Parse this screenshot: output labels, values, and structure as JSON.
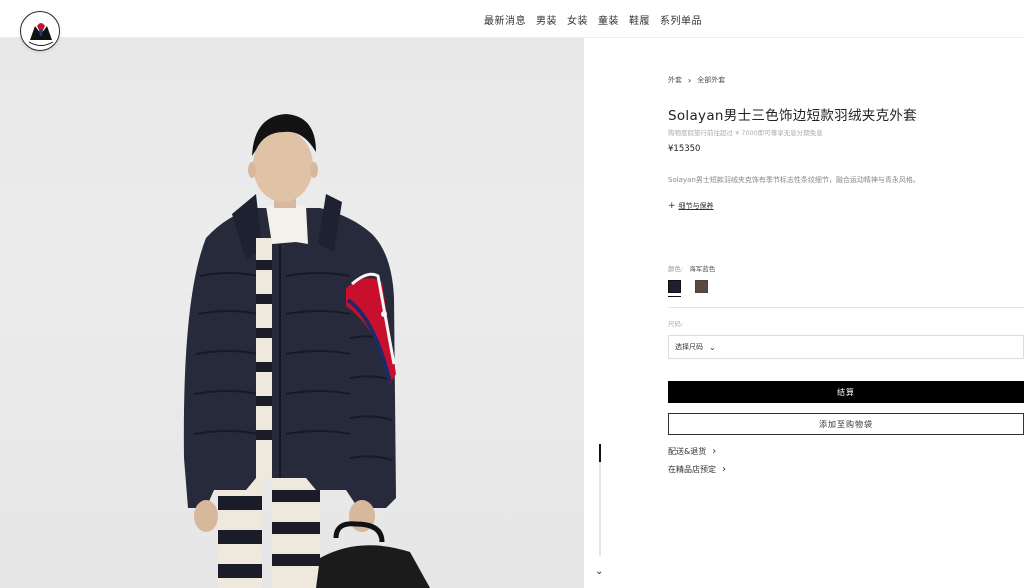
{
  "header": {
    "logo_text": "MONCLER",
    "nav": [
      "最新消息",
      "男装",
      "女装",
      "童装",
      "鞋履",
      "系列单品"
    ]
  },
  "photo": {
    "alt_icon": "product-photo"
  },
  "scroller": {
    "down_icon": "double-chevron-down-icon",
    "down_glyph": "⌄"
  },
  "product": {
    "breadcrumb": [
      "外套",
      "全部外套"
    ],
    "breadcrumb_sep": "›",
    "title": "Solayan男士三色饰边短款羽绒夹克外套",
    "subnote": "购物度假旅行前往超过 ¥ 7000即可尊享无息分期免息",
    "price": "¥15350",
    "description": "Solayan男士短款羽绒夹克饰有季节标志性条纹细节，融合运动精神与青永风格。",
    "details_link": "细节与保养",
    "details_plus": "+",
    "color_label": "颜色:",
    "color_value": "海军蓝色",
    "colors": [
      "#1c2033",
      "#5a4a40"
    ],
    "size_label": "尺码:",
    "size_placeholder": "选择尺码",
    "size_chevron": "⌄",
    "checkout_label": "结算",
    "add_to_bag_label": "添加至购物袋",
    "shipping_link": "配送&退货",
    "store_link": "在精品店预定",
    "link_chevron": "›"
  }
}
